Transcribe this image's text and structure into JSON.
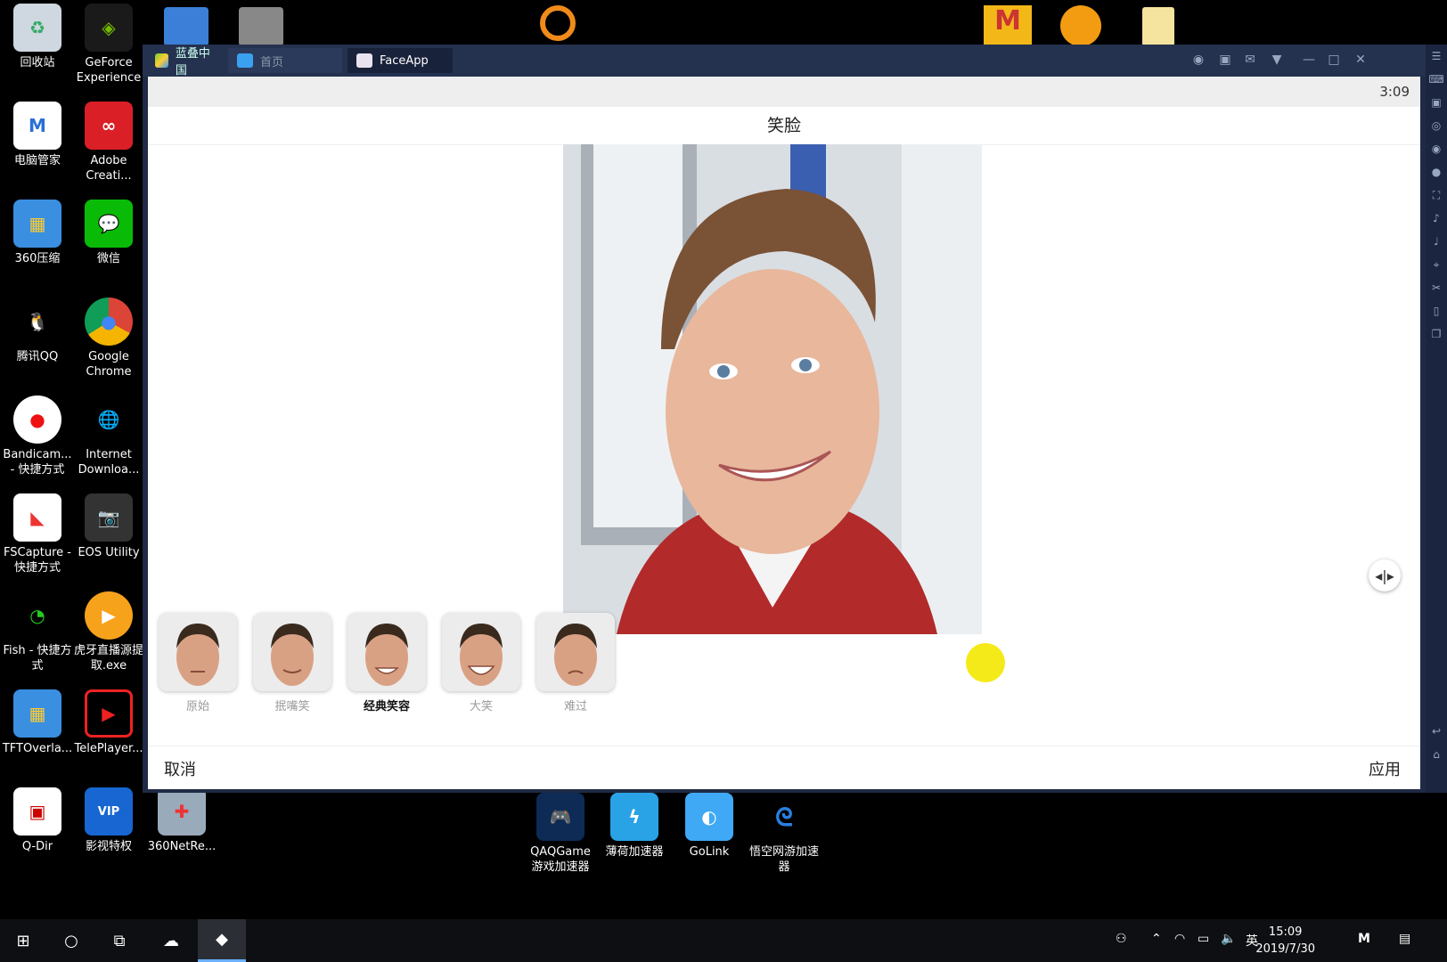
{
  "desktop": {
    "icons": [
      {
        "label": "回收站"
      },
      {
        "label": "GeForce Experience"
      },
      {
        "label": "电脑管家"
      },
      {
        "label": "Adobe Creati..."
      },
      {
        "label": "360压缩"
      },
      {
        "label": "微信"
      },
      {
        "label": "腾讯QQ"
      },
      {
        "label": "Google Chrome"
      },
      {
        "label": "Bandicam... - 快捷方式"
      },
      {
        "label": "Internet Downloa..."
      },
      {
        "label": "FSCapture - 快捷方式"
      },
      {
        "label": "EOS Utility"
      },
      {
        "label": "Fish - 快捷方式"
      },
      {
        "label": "虎牙直播源提取.exe"
      },
      {
        "label": "TFTOverla..."
      },
      {
        "label": "TelePlayer..."
      },
      {
        "label": "Q-Dir"
      },
      {
        "label": "影视特权"
      },
      {
        "label": "360NetRe..."
      },
      {
        "label": "QAQGame 游戏加速器"
      },
      {
        "label": "薄荷加速器"
      },
      {
        "label": "GoLink"
      },
      {
        "label": "悟空网游加速器"
      }
    ]
  },
  "emulator": {
    "brand": "蓝叠中国",
    "tabs": [
      {
        "label": "首页"
      },
      {
        "label": "FaceApp"
      }
    ]
  },
  "app": {
    "status_time": "3:09",
    "title": "笑脸",
    "filters": [
      {
        "label": "原始"
      },
      {
        "label": "抿嘴笑"
      },
      {
        "label": "经典笑容"
      },
      {
        "label": "大笑"
      },
      {
        "label": "难过"
      }
    ],
    "active_filter": "经典笑容",
    "cancel_label": "取消",
    "apply_label": "应用"
  },
  "taskbar": {
    "ime": "英",
    "time": "15:09",
    "date": "2019/7/30"
  },
  "colors": {
    "accent_yellow": "#f5ea19",
    "window_frame": "#24324f"
  }
}
